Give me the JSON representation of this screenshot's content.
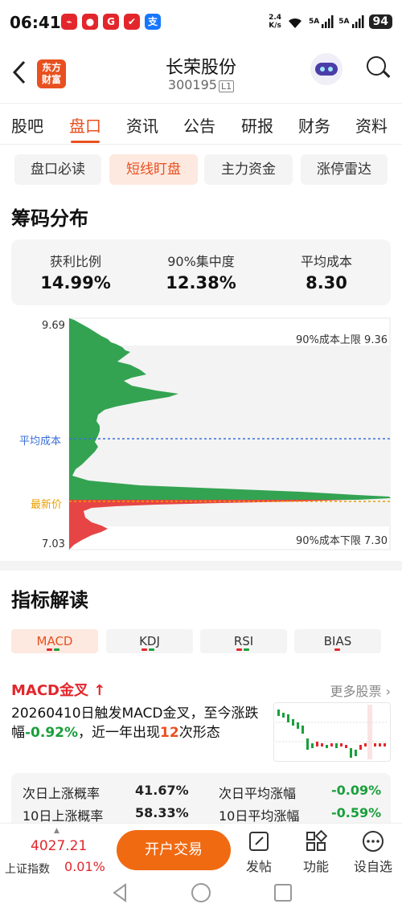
{
  "status_bar": {
    "time": "06:41",
    "net_speed_top": "2.4",
    "net_speed_unit": "K/s",
    "sim1": "5A",
    "sim2": "5A",
    "battery": "94",
    "app_icons": [
      {
        "name": "app-icon-1",
        "color": "#e3262c",
        "glyph": "⌁"
      },
      {
        "name": "app-icon-2",
        "color": "#e3262c",
        "glyph": "●"
      },
      {
        "name": "app-icon-3",
        "color": "#e3262c",
        "glyph": "G"
      },
      {
        "name": "app-icon-4",
        "color": "#e3262c",
        "glyph": "✔"
      },
      {
        "name": "alipay-icon",
        "color": "#1677ff",
        "glyph": "支"
      }
    ]
  },
  "header": {
    "logo_line1": "东方",
    "logo_line2": "财富",
    "stock_name": "长荣股份",
    "stock_code": "300195",
    "level_badge": "L1"
  },
  "tabs": [
    "股吧",
    "盘口",
    "资讯",
    "公告",
    "研报",
    "财务",
    "资料"
  ],
  "active_tab": "盘口",
  "subtabs": [
    "盘口必读",
    "短线盯盘",
    "主力资金",
    "涨停雷达"
  ],
  "active_subtab": "短线盯盘",
  "chip": {
    "title": "筹码分布",
    "stats": [
      {
        "label": "获利比例",
        "value": "14.99%"
      },
      {
        "label": "90%集中度",
        "value": "12.38%"
      },
      {
        "label": "平均成本",
        "value": "8.30"
      }
    ],
    "price_top": "9.69",
    "price_bottom": "7.03",
    "avg_cost_label": "平均成本",
    "latest_price_label": "最新价",
    "upper_limit_label": "90%成本上限 9.36",
    "lower_limit_label": "90%成本下限 7.30",
    "colors": {
      "profit": "#e74545",
      "loss": "#33a352",
      "avg_line": "#3a6fd8",
      "latest_line": "#e8a000"
    }
  },
  "indicators": {
    "title": "指标解读",
    "tabs": [
      "MACD",
      "KDJ",
      "RSI",
      "BIAS"
    ],
    "active_tab": "MACD",
    "signal_title": "MACD金叉",
    "more_link": "更多股票",
    "desc_part1": "20260410日触发MACD金叉，至今涨跌幅",
    "desc_change": "-0.92%",
    "desc_part2": "，近一年出现",
    "desc_count": "12",
    "desc_part3": "次形态",
    "stats": [
      {
        "label": "次日上涨概率",
        "value": "41.67%",
        "color": "#222"
      },
      {
        "label": "次日平均涨幅",
        "value": "-0.09%",
        "color": "#1a9f3b"
      },
      {
        "label": "10日上涨概率",
        "value": "58.33%",
        "color": "#222"
      },
      {
        "label": "10日平均涨幅",
        "value": "-0.59%",
        "color": "#1a9f3b"
      }
    ]
  },
  "bottom_bar": {
    "index_value": "4027.21",
    "index_name": "上证指数",
    "index_change": "0.01%",
    "open_account_label": "开户交易",
    "items": [
      {
        "name": "post-button",
        "label": "发帖",
        "icon": "edit-icon"
      },
      {
        "name": "function-button",
        "label": "功能",
        "icon": "grid-icon"
      },
      {
        "name": "custom-select-button",
        "label": "设自选",
        "icon": "more-icon"
      }
    ]
  }
}
